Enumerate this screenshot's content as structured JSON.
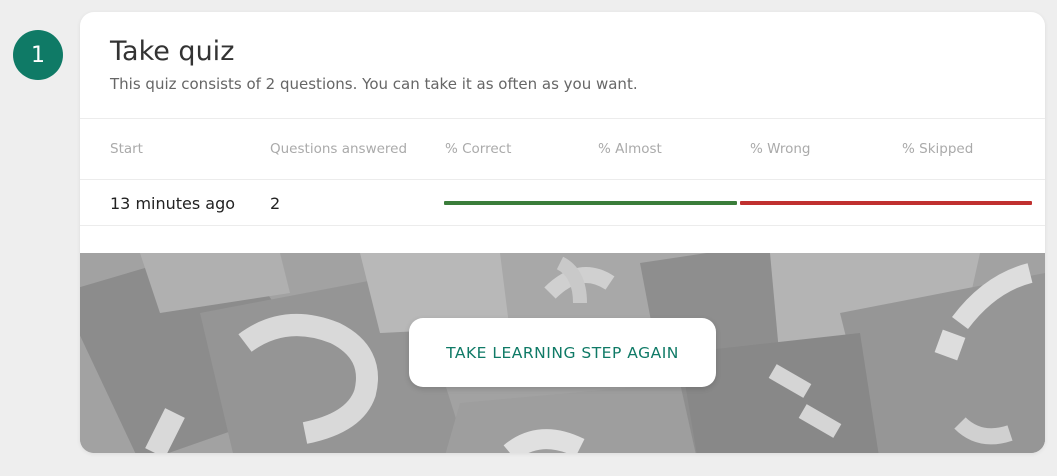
{
  "step": {
    "number": "1"
  },
  "card": {
    "title": "Take quiz",
    "subtitle": "This quiz consists of 2 questions. You can take it as often as you want."
  },
  "table": {
    "headers": [
      "Start",
      "Questions answered",
      "% Correct",
      "% Almost",
      "% Wrong",
      "% Skipped"
    ],
    "row": {
      "start": "13 minutes ago",
      "questions_answered": "2",
      "percent_correct": 50,
      "percent_almost": 0,
      "percent_wrong": 50,
      "percent_skipped": 0
    }
  },
  "colors": {
    "accent": "#0f7a66",
    "correct": "#3a7d3a",
    "wrong": "#c0302f"
  },
  "cta": {
    "label": "TAKE LEARNING STEP AGAIN"
  },
  "hero": {
    "image": "question-marks-background"
  }
}
